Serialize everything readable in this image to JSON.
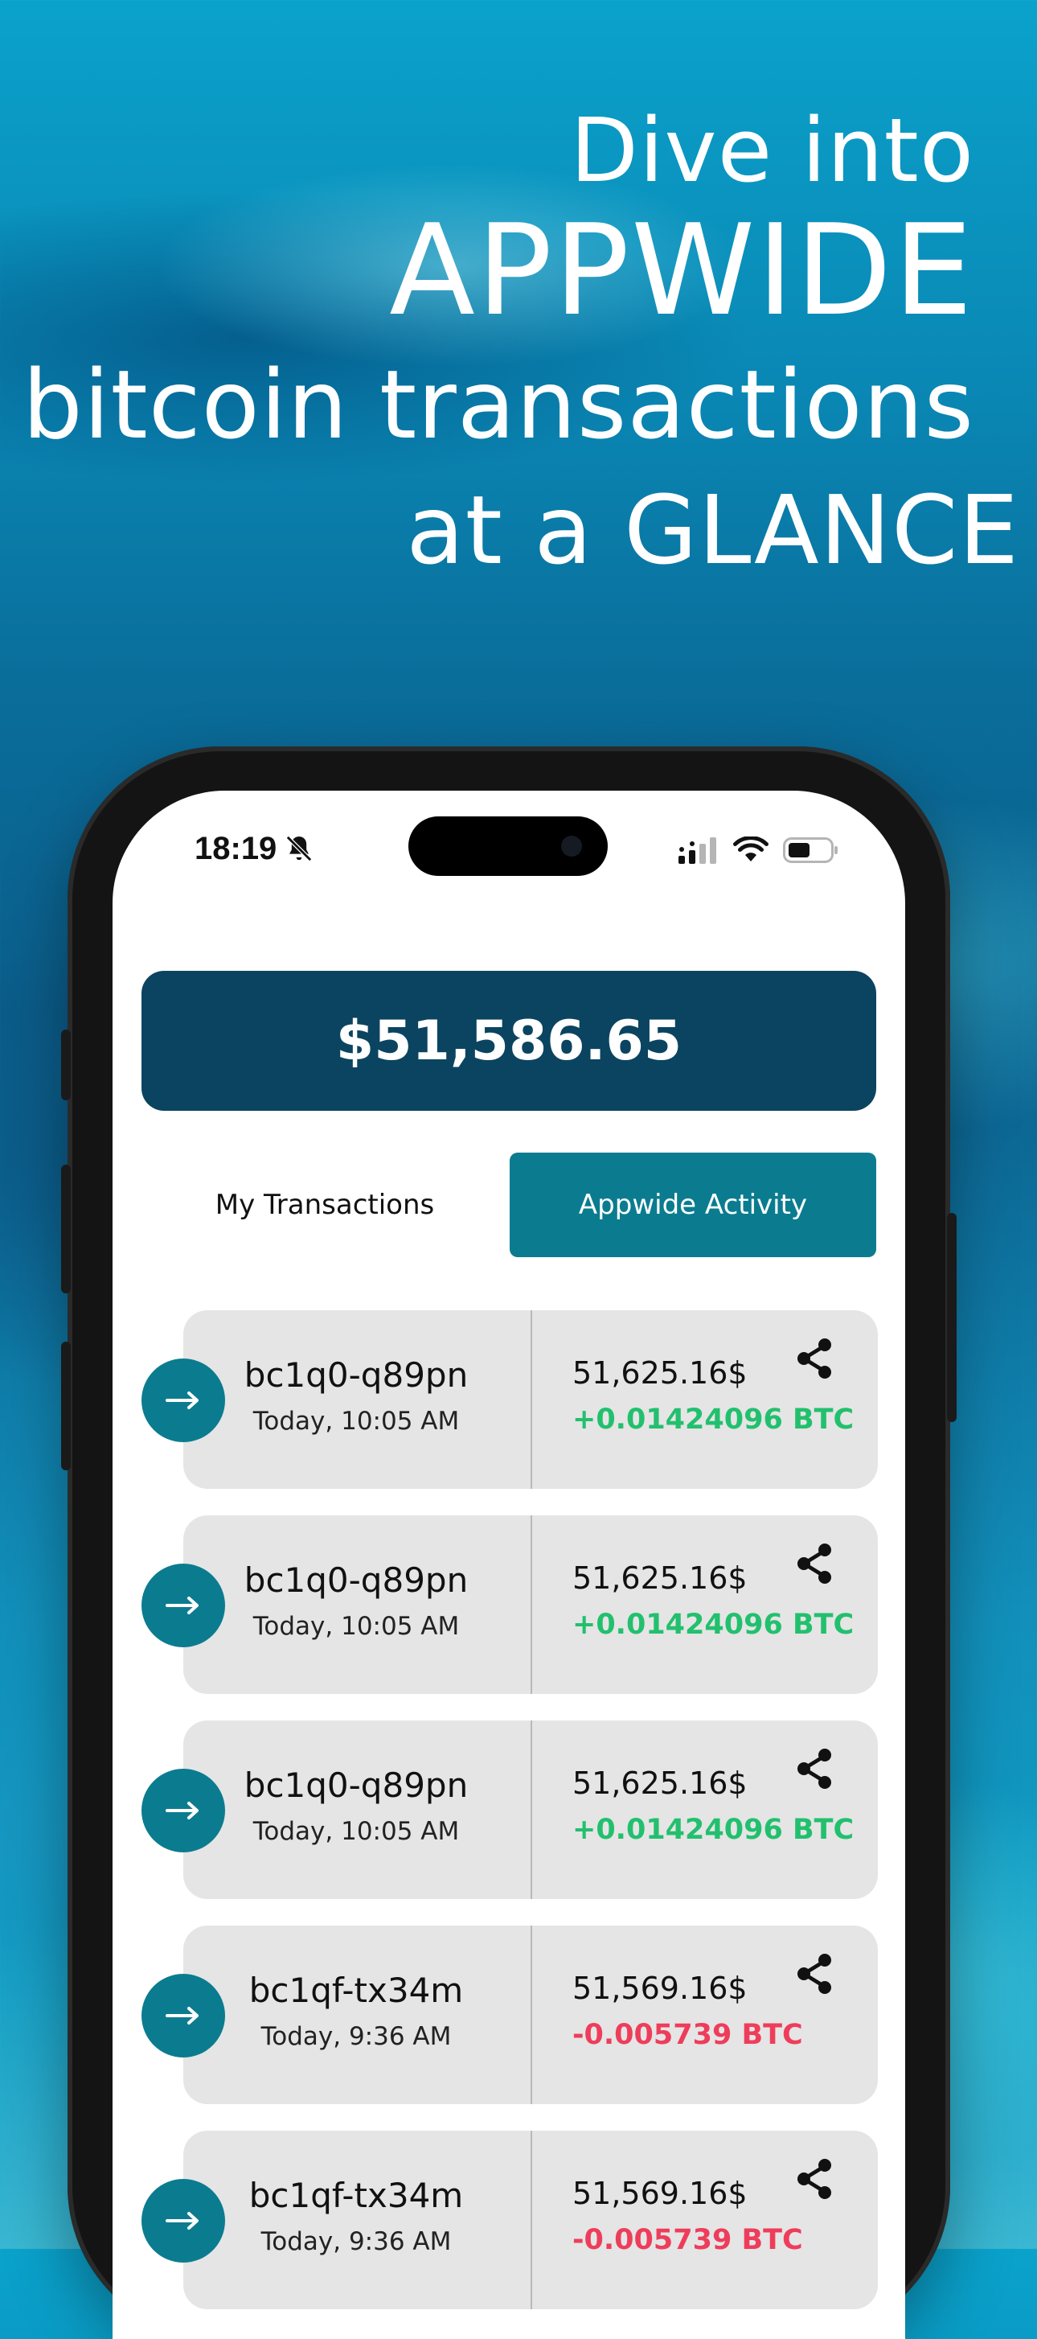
{
  "headline": {
    "line1": "Dive into",
    "line2": "APPWIDE",
    "line3": "bitcoin transactions",
    "line4": "at a GLANCE"
  },
  "status_bar": {
    "time": "18:19"
  },
  "balance": "$51,586.65",
  "tabs": {
    "my_transactions": "My Transactions",
    "appwide_activity": "Appwide Activity",
    "active": "appwide_activity"
  },
  "colors": {
    "primary_dark": "#0b4460",
    "accent": "#0b7c8f",
    "positive": "#22c06e",
    "negative": "#ee3d5b"
  },
  "transactions": [
    {
      "address": "bc1q0-q89pn",
      "time": "Today, 10:05 AM",
      "usd": "51,625.16$",
      "btc": "+0.01424096 BTC",
      "direction": "positive"
    },
    {
      "address": "bc1q0-q89pn",
      "time": "Today, 10:05 AM",
      "usd": "51,625.16$",
      "btc": "+0.01424096 BTC",
      "direction": "positive"
    },
    {
      "address": "bc1q0-q89pn",
      "time": "Today, 10:05 AM",
      "usd": "51,625.16$",
      "btc": "+0.01424096 BTC",
      "direction": "positive"
    },
    {
      "address": "bc1qf-tx34m",
      "time": "Today, 9:36 AM",
      "usd": "51,569.16$",
      "btc": "-0.005739 BTC",
      "direction": "negative"
    },
    {
      "address": "bc1qf-tx34m",
      "time": "Today, 9:36 AM",
      "usd": "51,569.16$",
      "btc": "-0.005739 BTC",
      "direction": "negative"
    }
  ]
}
